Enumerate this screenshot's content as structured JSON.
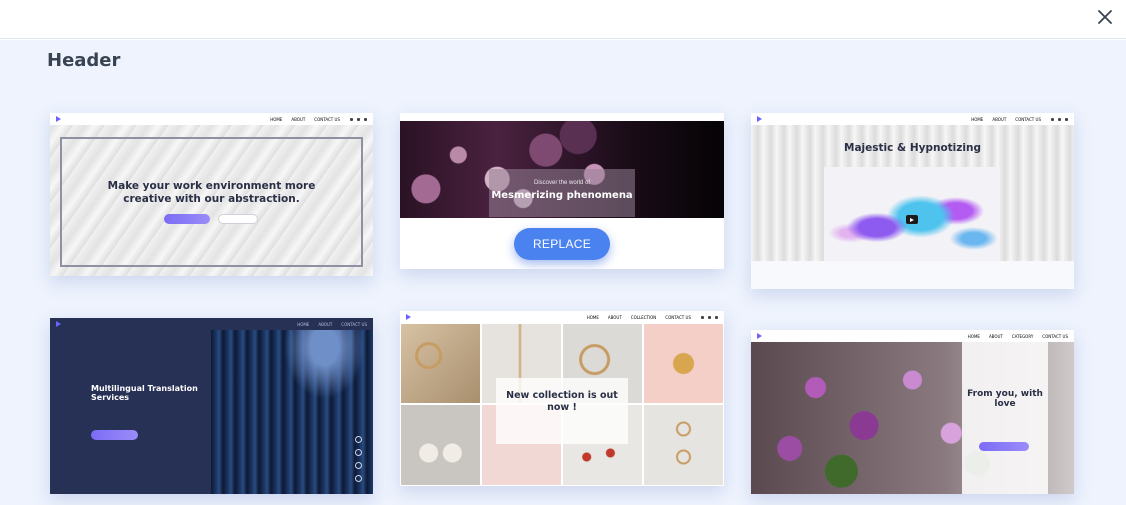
{
  "dialog": {
    "close_icon": "close-icon"
  },
  "section": {
    "title": "Header"
  },
  "templates": [
    {
      "id": "header-1",
      "nav_links": [
        "HOME",
        "ABOUT",
        "CONTACT US"
      ],
      "headline": "Make your work environment more creative with our abstraction.",
      "style": "abstract-white-waves"
    },
    {
      "id": "header-2",
      "small_text": "Discover the world of",
      "headline": "Mesmerizing phenomena",
      "action_label": "REPLACE",
      "style": "dark-fluid-art"
    },
    {
      "id": "header-3",
      "nav_links": [
        "HOME",
        "ABOUT",
        "CONTACT US"
      ],
      "headline": "Majestic & Hypnotizing",
      "style": "video-colorful-smoke"
    },
    {
      "id": "header-4",
      "nav_links": [
        "HOME",
        "ABOUT",
        "CONTACT US"
      ],
      "headline": "Multilingual Translation Services",
      "style": "dark-navy-library"
    },
    {
      "id": "header-5",
      "nav_links": [
        "HOME",
        "ABOUT",
        "COLLECTION",
        "CONTACT US"
      ],
      "headline": "New collection is out now !",
      "style": "jewelry-grid"
    },
    {
      "id": "header-6",
      "nav_links": [
        "HOME",
        "ABOUT",
        "CATEGORY",
        "CONTACT US"
      ],
      "headline": "From you, with love",
      "style": "purple-flowers"
    }
  ],
  "colors": {
    "accent": "#4a82f0",
    "panel_bg": "#eef3fd",
    "title": "#3a4352"
  }
}
